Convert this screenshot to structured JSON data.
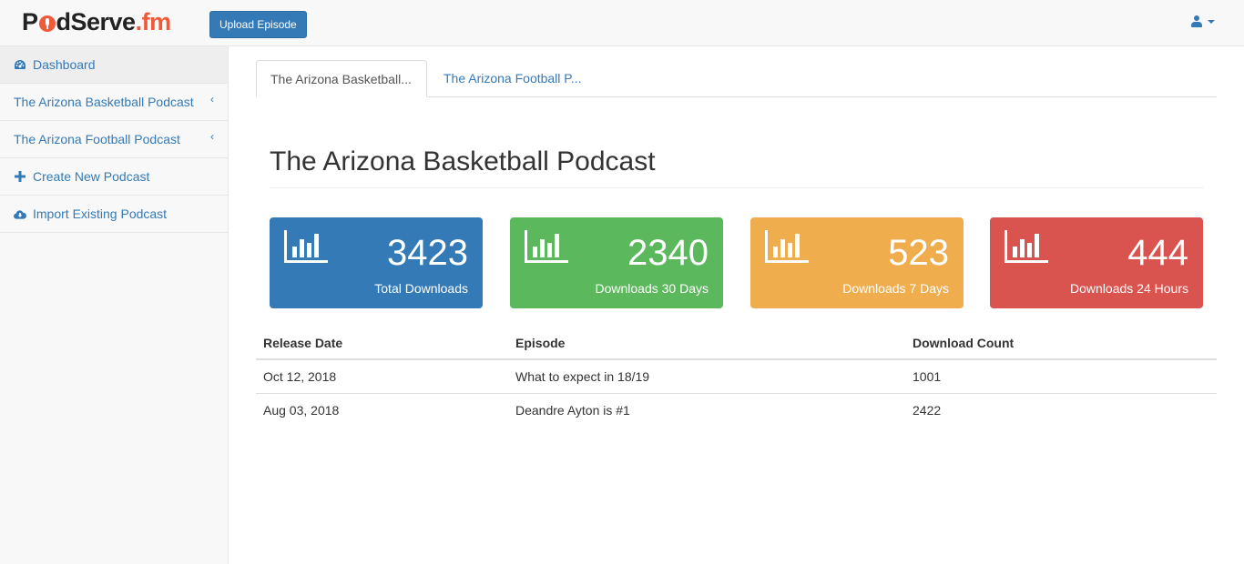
{
  "navbar": {
    "brand": {
      "part1": "P",
      "part2": "dServe",
      "part3": ".fm"
    },
    "upload_button": "Upload Episode",
    "user_icon": "user-icon",
    "caret_icon": "caret-down-icon"
  },
  "sidebar": {
    "items": [
      {
        "label": "Dashboard",
        "icon": "dashboard-icon",
        "active": true
      },
      {
        "label": "The Arizona Basketball Podcast",
        "icon": "chevron-left-icon"
      },
      {
        "label": "The Arizona Football Podcast",
        "icon": "chevron-left-icon"
      },
      {
        "label": "Create New Podcast",
        "icon": "plus-icon"
      },
      {
        "label": "Import Existing Podcast",
        "icon": "cloud-download-icon"
      }
    ]
  },
  "tabs": [
    {
      "label": "The Arizona Basketball...",
      "active": true
    },
    {
      "label": "The Arizona Football P...",
      "active": false
    }
  ],
  "page_title": "The Arizona Basketball Podcast",
  "stats": [
    {
      "value": "3423",
      "label": "Total Downloads",
      "color": "#337ab7",
      "icon": "bar-chart-icon"
    },
    {
      "value": "2340",
      "label": "Downloads 30 Days",
      "color": "#5cb85c",
      "icon": "bar-chart-icon"
    },
    {
      "value": "523",
      "label": "Downloads 7 Days",
      "color": "#f0ad4e",
      "icon": "bar-chart-icon"
    },
    {
      "value": "444",
      "label": "Downloads 24 Hours",
      "color": "#d9534f",
      "icon": "bar-chart-icon"
    }
  ],
  "table": {
    "headers": [
      "Release Date",
      "Episode",
      "Download Count"
    ],
    "rows": [
      [
        "Oct 12, 2018",
        "What to expect in 18/19",
        "1001"
      ],
      [
        "Aug 03, 2018",
        "Deandre Ayton is #1",
        "2422"
      ]
    ]
  }
}
